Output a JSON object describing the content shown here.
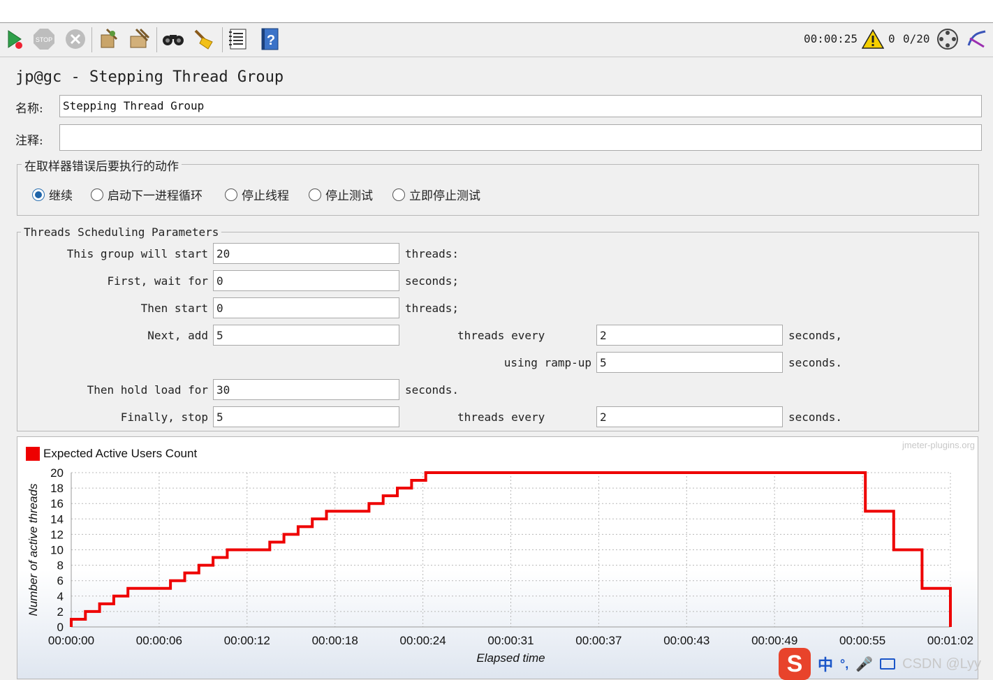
{
  "toolbar": {
    "timer": "00:00:25",
    "warnings": "0",
    "threads": "0/20",
    "icons": [
      "start-icon",
      "stop-icon",
      "shutdown-icon",
      "clear-icon",
      "clear-all-icon",
      "search-icon",
      "reset-search-icon",
      "function-helper-icon",
      "help-icon",
      "remote-icon",
      "log-icon"
    ]
  },
  "panel": {
    "title": "jp@gc - Stepping Thread Group",
    "name_label": "名称:",
    "name_value": "Stepping Thread Group",
    "comment_label": "注释:",
    "comment_value": ""
  },
  "error_action": {
    "legend": "在取样器错误后要执行的动作",
    "options": [
      "继续",
      "启动下一进程循环",
      "停止线程",
      "停止测试",
      "立即停止测试"
    ],
    "selected": "继续"
  },
  "params": {
    "legend": "Threads Scheduling Parameters",
    "start_label": "This group will start",
    "start_value": "20",
    "start_unit": "threads:",
    "wait_label": "First, wait for",
    "wait_value": "0",
    "wait_unit": "seconds;",
    "then_label": "Then start",
    "then_value": "0",
    "then_unit": "threads;",
    "next_label": "Next, add",
    "next_value": "5",
    "next_mid": "threads every",
    "next_every": "2",
    "next_unit": "seconds,",
    "ramp_label": "using ramp-up",
    "ramp_value": "5",
    "ramp_unit": "seconds.",
    "hold_label": "Then hold load for",
    "hold_value": "30",
    "hold_unit": "seconds.",
    "stop_label": "Finally, stop",
    "stop_value": "5",
    "stop_mid": "threads every",
    "stop_every": "2",
    "stop_unit": "seconds."
  },
  "chart_data": {
    "type": "line",
    "watermark": "jmeter-plugins.org",
    "xlabel": "Elapsed time",
    "ylabel": "Number of active threads",
    "ylim": [
      0,
      20
    ],
    "xlim": [
      0,
      62
    ],
    "x_ticks": [
      "00:00:00",
      "00:00:06",
      "00:00:12",
      "00:00:18",
      "00:00:24",
      "00:00:31",
      "00:00:37",
      "00:00:43",
      "00:00:49",
      "00:00:55",
      "00:01:02"
    ],
    "y_ticks": [
      0,
      2,
      4,
      6,
      8,
      10,
      12,
      14,
      16,
      18,
      20
    ],
    "grid": true,
    "legend_position": "top-left",
    "series": [
      {
        "name": "Expected Active Users Count",
        "color": "#ee0000",
        "points": [
          [
            0,
            0
          ],
          [
            0,
            1
          ],
          [
            1,
            1
          ],
          [
            1,
            2
          ],
          [
            2,
            2
          ],
          [
            2,
            3
          ],
          [
            3,
            3
          ],
          [
            3,
            4
          ],
          [
            4,
            4
          ],
          [
            4,
            5
          ],
          [
            7,
            5
          ],
          [
            7,
            6
          ],
          [
            8,
            6
          ],
          [
            8,
            7
          ],
          [
            9,
            7
          ],
          [
            9,
            8
          ],
          [
            10,
            8
          ],
          [
            10,
            9
          ],
          [
            11,
            9
          ],
          [
            11,
            10
          ],
          [
            14,
            10
          ],
          [
            14,
            11
          ],
          [
            15,
            11
          ],
          [
            15,
            12
          ],
          [
            16,
            12
          ],
          [
            16,
            13
          ],
          [
            17,
            13
          ],
          [
            17,
            14
          ],
          [
            18,
            14
          ],
          [
            18,
            15
          ],
          [
            21,
            15
          ],
          [
            21,
            16
          ],
          [
            22,
            16
          ],
          [
            22,
            17
          ],
          [
            23,
            17
          ],
          [
            23,
            18
          ],
          [
            24,
            18
          ],
          [
            24,
            19
          ],
          [
            25,
            19
          ],
          [
            25,
            20
          ],
          [
            56,
            20
          ],
          [
            56,
            15
          ],
          [
            58,
            15
          ],
          [
            58,
            10
          ],
          [
            60,
            10
          ],
          [
            60,
            5
          ],
          [
            62,
            5
          ],
          [
            62,
            0
          ]
        ]
      }
    ]
  },
  "ime": {
    "brand": "S",
    "lang": "中",
    "punct": "°,",
    "watermark": "CSDN @Lyy"
  }
}
